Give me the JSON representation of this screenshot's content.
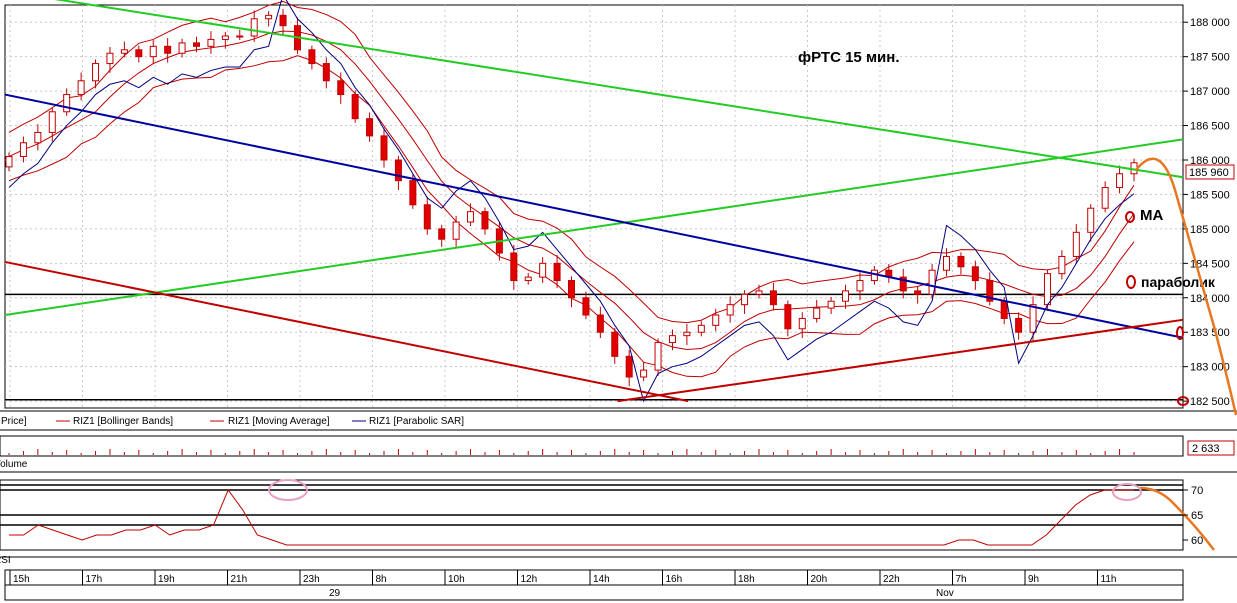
{
  "chart_data": {
    "type": "candlestick",
    "annotation_title": "фРТС   15 мин.",
    "price_axis": {
      "ylim": [
        182400,
        188250
      ],
      "ticks": [
        "188 000",
        "187 500",
        "187 000",
        "186 500",
        "186 000",
        "185 500",
        "185 000",
        "184 500",
        "184 000",
        "183 500",
        "183 000",
        "182 500"
      ],
      "tick_values": [
        188000,
        187500,
        187000,
        186500,
        186000,
        185500,
        185000,
        184500,
        184000,
        183500,
        183000,
        182500
      ],
      "last_price_label": "185 960",
      "last_price": 185960
    },
    "volume_label": "2 633",
    "volume_panel_label": "Volume",
    "rsi_panel_label": "RSI",
    "rsi_axis": {
      "ylim": [
        58,
        72
      ],
      "ticks": [
        "70",
        "65",
        "60"
      ],
      "tick_values": [
        70,
        65,
        60
      ]
    },
    "legend": [
      {
        "label": "Price]",
        "color": "#000000"
      },
      {
        "label": "RIZ1 [Bollinger Bands]",
        "color": "#c00000"
      },
      {
        "label": "RIZ1 [Moving Average]",
        "color": "#c00000"
      },
      {
        "label": "RIZ1 [Parabolic SAR]",
        "color": "#000080"
      }
    ],
    "x_ticks": [
      "15h",
      "17h",
      "19h",
      "21h",
      "23h",
      "8h",
      "10h",
      "12h",
      "14h",
      "16h",
      "18h",
      "20h",
      "22h",
      "7h",
      "9h",
      "11h"
    ],
    "date_labels": [
      "29",
      "Nov"
    ],
    "annotations": [
      "MA",
      "параболик"
    ],
    "horizontal_levels": [
      184050,
      182520
    ],
    "green_channel": {
      "upper": {
        "from": [
          0,
          188450
        ],
        "to": [
          1,
          185750
        ]
      },
      "lower": {
        "from": [
          0,
          183750
        ],
        "to": [
          1,
          186300
        ]
      }
    },
    "blue_trend": {
      "from": [
        0,
        186950
      ],
      "to": [
        1,
        183420
      ]
    },
    "red_support": {
      "from": [
        0.52,
        182500
      ],
      "to": [
        1,
        183680
      ]
    },
    "red_resistance": {
      "from": [
        0,
        184520
      ],
      "to": [
        0.58,
        182500
      ]
    },
    "close_series": [
      186050,
      186250,
      186400,
      186700,
      186950,
      187150,
      187400,
      187550,
      187600,
      187500,
      187650,
      187550,
      187700,
      187650,
      187750,
      187800,
      187800,
      188050,
      188100,
      187950,
      187600,
      187400,
      187150,
      186950,
      186600,
      186350,
      186000,
      185700,
      185350,
      185000,
      184850,
      185100,
      185250,
      185000,
      184650,
      184250,
      184300,
      184500,
      184250,
      184000,
      183750,
      183500,
      183150,
      182850,
      182950,
      183350,
      183450,
      183500,
      183600,
      183750,
      183900,
      184050,
      184100,
      183900,
      183550,
      183700,
      183850,
      183950,
      184100,
      184250,
      184400,
      184300,
      184100,
      184050,
      184400,
      184600,
      184450,
      184250,
      183950,
      183700,
      183500,
      183900,
      184350,
      184600,
      184950,
      185300,
      185600,
      185800,
      185960
    ],
    "rsi_series": [
      61,
      61,
      63,
      62,
      61,
      60,
      61,
      61,
      62,
      62,
      63,
      61,
      62,
      62,
      63,
      70,
      66,
      61,
      60,
      59,
      59,
      59,
      59,
      59,
      59,
      59,
      59,
      59,
      59,
      59,
      59,
      59,
      59,
      59,
      59,
      59,
      59,
      59,
      59,
      59,
      59,
      59,
      59,
      59,
      59,
      59,
      59,
      59,
      59,
      59,
      59,
      59,
      59,
      59,
      59,
      59,
      59,
      59,
      59,
      59,
      59,
      59,
      59,
      59,
      59,
      60,
      60,
      59,
      59,
      59,
      59,
      61,
      64,
      67,
      69,
      70,
      70,
      70
    ]
  }
}
